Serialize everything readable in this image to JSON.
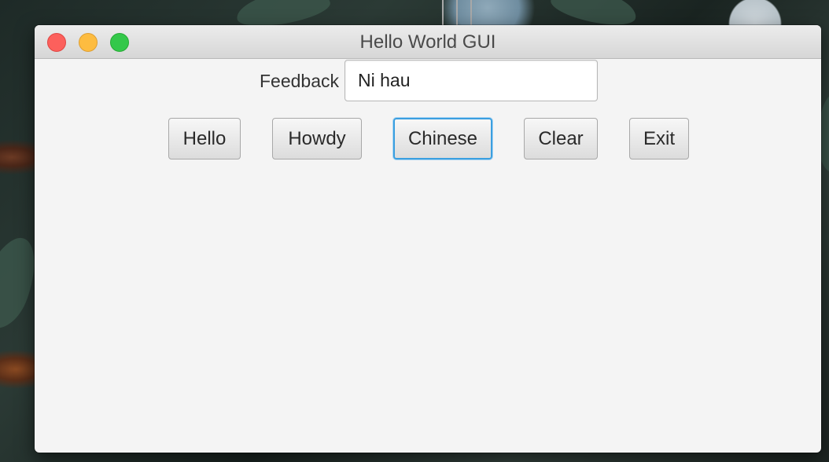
{
  "window": {
    "title": "Hello World GUI",
    "controls": [
      "close",
      "minimize",
      "maximize"
    ]
  },
  "feedback": {
    "label": "Feedback",
    "value": "Ni hau"
  },
  "buttons": {
    "hello": "Hello",
    "howdy": "Howdy",
    "chinese": "Chinese",
    "clear": "Clear",
    "exit": "Exit"
  },
  "focused_button": "chinese",
  "colors": {
    "close": "#fc605c",
    "minimize": "#fdbc40",
    "maximize": "#34c84a",
    "focus_ring": "#3a9fe0",
    "window_background": "#f4f4f4"
  }
}
